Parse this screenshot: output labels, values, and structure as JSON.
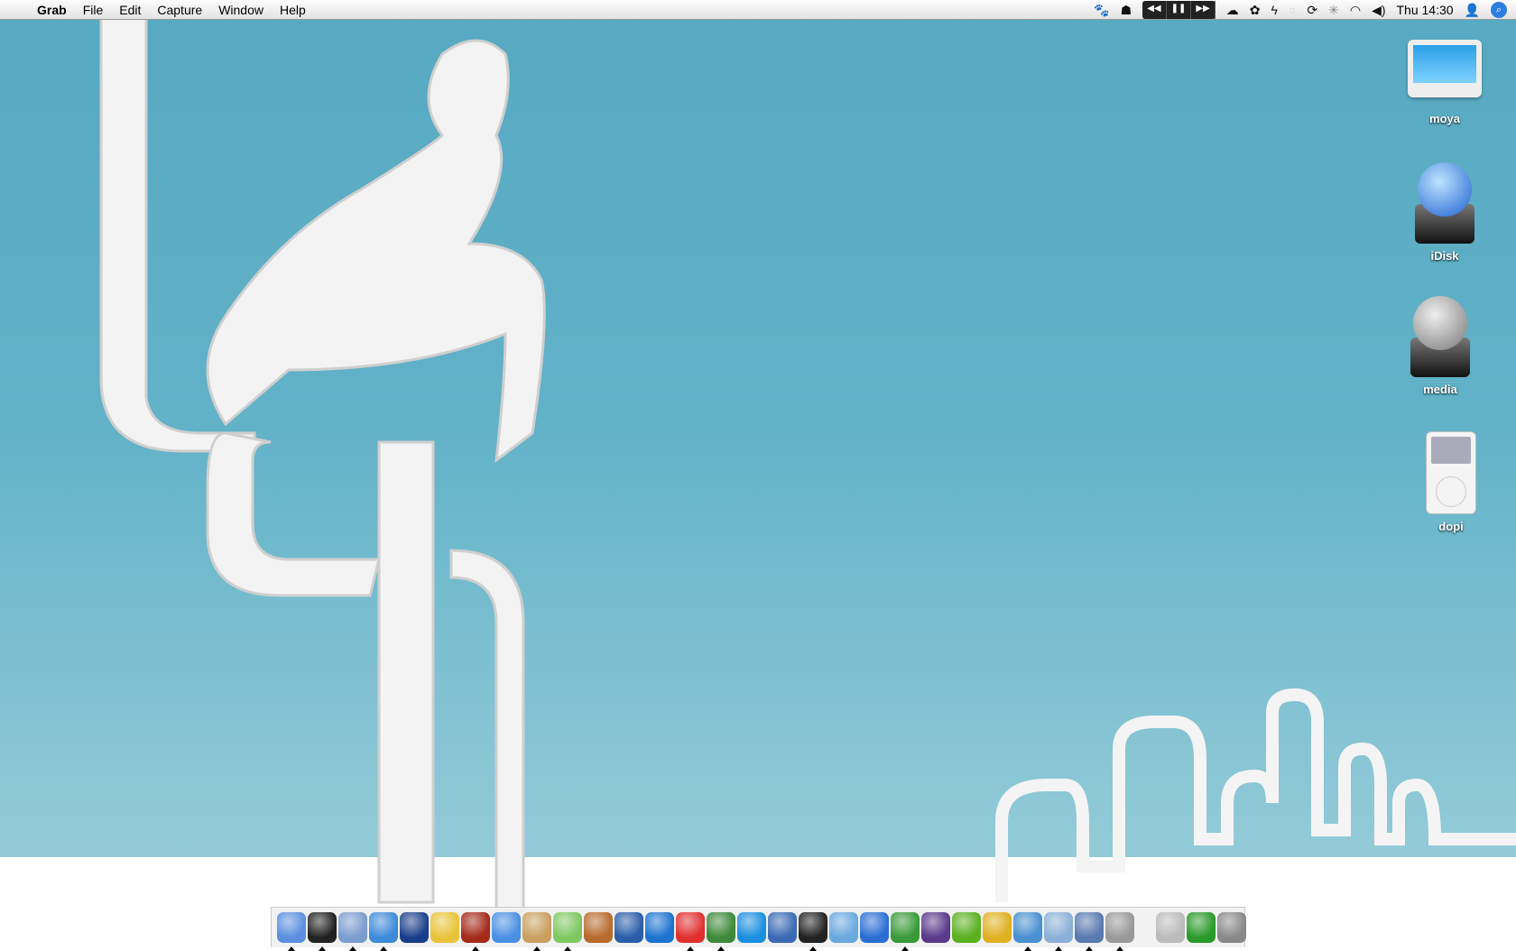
{
  "menubar": {
    "app": "Grab",
    "items": [
      "File",
      "Edit",
      "Capture",
      "Window",
      "Help"
    ],
    "clock": "Thu 14:30",
    "status_icons": [
      "paw-icon",
      "hood-icon",
      "rewind-icon",
      "pause-icon",
      "fast-forward-icon",
      "ghost-icon",
      "growl-icon",
      "flash-icon",
      "chat-bubble-icon",
      "sync-icon",
      "bluetooth-icon",
      "wifi-icon",
      "volume-icon",
      "user-icon",
      "spotlight-icon"
    ]
  },
  "desktop": {
    "icons": [
      {
        "label": "moya",
        "type": "computer"
      },
      {
        "label": "iDisk",
        "type": "idisk"
      },
      {
        "label": "media",
        "type": "network-drive"
      },
      {
        "label": "dopi",
        "type": "ipod"
      }
    ]
  },
  "dock": {
    "apps": [
      {
        "name": "finder",
        "color": "#5b8fe0",
        "running": true
      },
      {
        "name": "dashboard",
        "color": "#222",
        "running": true
      },
      {
        "name": "mail-stamp",
        "color": "#7a9ccf",
        "running": true
      },
      {
        "name": "safari",
        "color": "#3e8ad9",
        "running": true
      },
      {
        "name": "golive",
        "color": "#1a3f8a",
        "running": false
      },
      {
        "name": "network",
        "color": "#e9c43a",
        "running": false
      },
      {
        "name": "domo",
        "color": "#a52a1a",
        "running": true
      },
      {
        "name": "ichat",
        "color": "#4a90e2",
        "running": false
      },
      {
        "name": "address-book",
        "color": "#c9a060",
        "running": true
      },
      {
        "name": "itunes",
        "color": "#7fc860",
        "running": true
      },
      {
        "name": "iphoto",
        "color": "#b86b2e",
        "running": false
      },
      {
        "name": "imovie",
        "color": "#2a5ea8",
        "running": false
      },
      {
        "name": "idvd",
        "color": "#1c74d0",
        "running": false
      },
      {
        "name": "ical",
        "color": "#e03030",
        "running": true
      },
      {
        "name": "cyberduck",
        "color": "#3e8a3a",
        "running": true
      },
      {
        "name": "quicktime",
        "color": "#1a8fe0",
        "running": false
      },
      {
        "name": "preview",
        "color": "#3a6ab5",
        "running": false
      },
      {
        "name": "terminal",
        "color": "#222",
        "running": true
      },
      {
        "name": "search-tool",
        "color": "#6aa8e0",
        "running": false
      },
      {
        "name": "word",
        "color": "#2a6ed4",
        "running": false
      },
      {
        "name": "excel",
        "color": "#3a9a3a",
        "running": true
      },
      {
        "name": "wizard",
        "color": "#5a3a8a",
        "running": false
      },
      {
        "name": "dreamweaver",
        "color": "#5ab020",
        "running": false
      },
      {
        "name": "fireworks",
        "color": "#e0b020",
        "running": false
      },
      {
        "name": "xcode",
        "color": "#4a90d0",
        "running": true
      },
      {
        "name": "windows",
        "color": "#8ab0d8",
        "running": true
      },
      {
        "name": "image-capture",
        "color": "#5a7ab0",
        "running": true
      },
      {
        "name": "utility",
        "color": "#999",
        "running": true
      }
    ],
    "extras": [
      {
        "name": "mail-at",
        "color": "#bbb"
      },
      {
        "name": "vnc",
        "color": "#2a9a2a"
      },
      {
        "name": "trash",
        "color": "#888"
      }
    ]
  }
}
